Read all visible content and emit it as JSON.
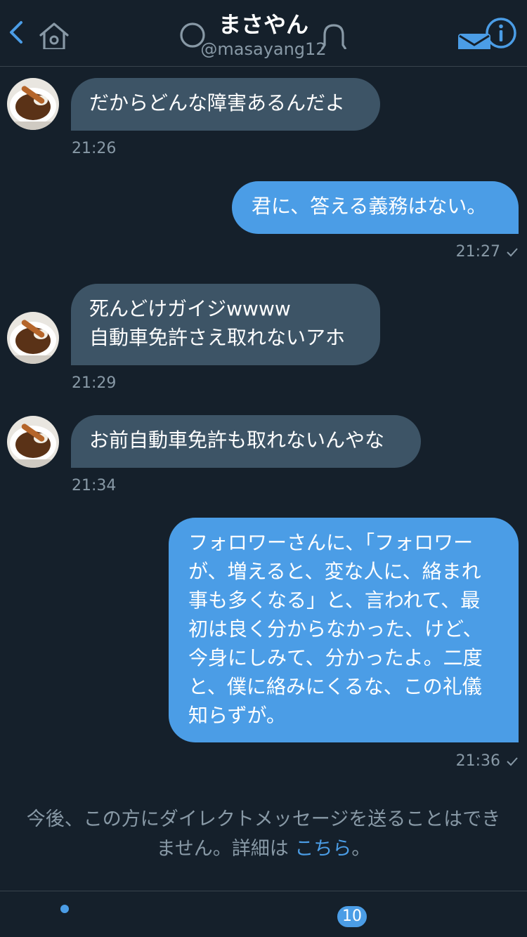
{
  "header": {
    "name": "まさやん",
    "handle": "@masayang12",
    "back_icon": "chevron-left-icon",
    "info_icon": "info-icon",
    "accent_color": "#4b9de6"
  },
  "messages": [
    {
      "direction": "incoming",
      "text": "だからどんな障害あるんだよ",
      "time": "21:26"
    },
    {
      "direction": "outgoing",
      "text": "君に、答える義務はない。",
      "time": "21:27",
      "status_icon": "check-icon"
    },
    {
      "direction": "incoming",
      "text": "死んどけガイジwwww\n自動車免許さえ取れないアホ",
      "time": "21:29"
    },
    {
      "direction": "incoming",
      "text": "お前自動車免許も取れないんやな",
      "time": "21:34"
    },
    {
      "direction": "outgoing",
      "text": "フォロワーさんに、「フォロワー\nが、増えると、変な人に、絡まれ\n事も多くなる」と、言われて、最\n初は良く分からなかった、けど、\n今身にしみて、分かったよ。二度\nと、僕に絡みにくるな、この礼儀\n知らずが。",
      "time": "21:36",
      "status_icon": "check-icon"
    }
  ],
  "notice": {
    "line1": "今後、この方にダイレクトメッセージを送ることはでき",
    "line2_prefix": "ません。詳細は ",
    "link": "こちら",
    "line2_suffix": "。"
  },
  "tabbar": {
    "tabs": [
      {
        "name": "home",
        "icon": "home-icon",
        "has_dot": true
      },
      {
        "name": "search",
        "icon": "search-icon"
      },
      {
        "name": "notifications",
        "icon": "bell-icon",
        "badge": "10"
      },
      {
        "name": "messages",
        "icon": "mail-icon",
        "active": true
      }
    ]
  }
}
